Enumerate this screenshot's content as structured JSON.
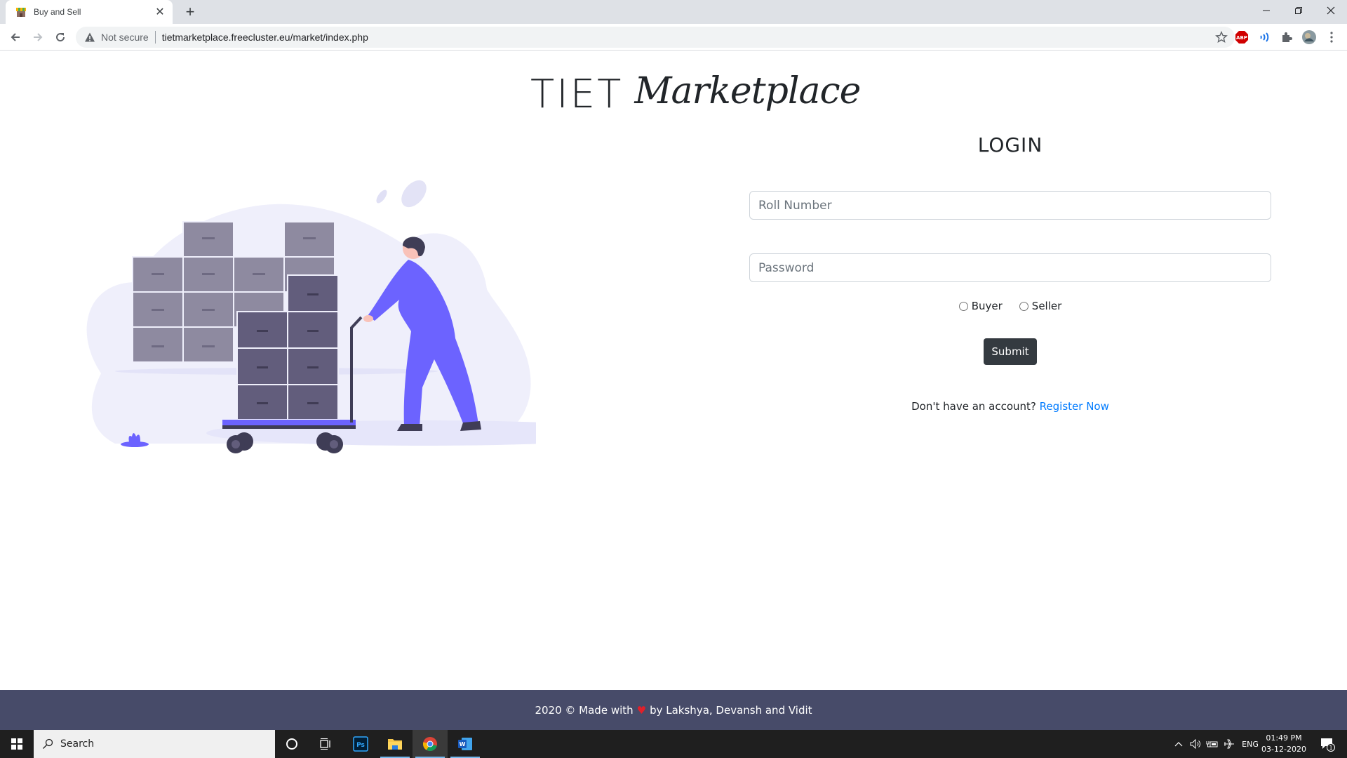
{
  "browser": {
    "tab_title": "Buy and Sell",
    "security_label": "Not secure",
    "url": "tietmarketplace.freecluster.eu/market/index.php",
    "extensions": [
      "adblock-plus",
      "reader-extension",
      "extensions-puzzle",
      "profile-avatar"
    ],
    "abp_label": "ABP"
  },
  "page": {
    "brand_prefix": "TIET",
    "brand_script": "Marketplace",
    "login_title": "LOGIN",
    "roll_placeholder": "Roll Number",
    "roll_value": "",
    "password_placeholder": "Password",
    "password_value": "",
    "role_options": [
      "Buyer",
      "Seller"
    ],
    "role_selected": null,
    "submit_label": "Submit",
    "register_prompt": "Don't have an account?",
    "register_link": "Register Now",
    "colors": {
      "accent": "#6c63ff",
      "button": "#343a40",
      "link": "#007bff",
      "footer_bg": "#474b69"
    }
  },
  "footer": {
    "prefix": "2020 © Made with",
    "heart": "♥",
    "suffix": "by Lakshya, Devansh and Vidit"
  },
  "taskbar": {
    "search_placeholder": "Search",
    "apps": [
      "cortana",
      "task-view",
      "photoshop",
      "file-explorer",
      "chrome",
      "word"
    ],
    "ps_label": "Ps",
    "word_label": "W",
    "language": "ENG",
    "time": "01:49 PM",
    "date": "03-12-2020",
    "notification_count": "1"
  }
}
